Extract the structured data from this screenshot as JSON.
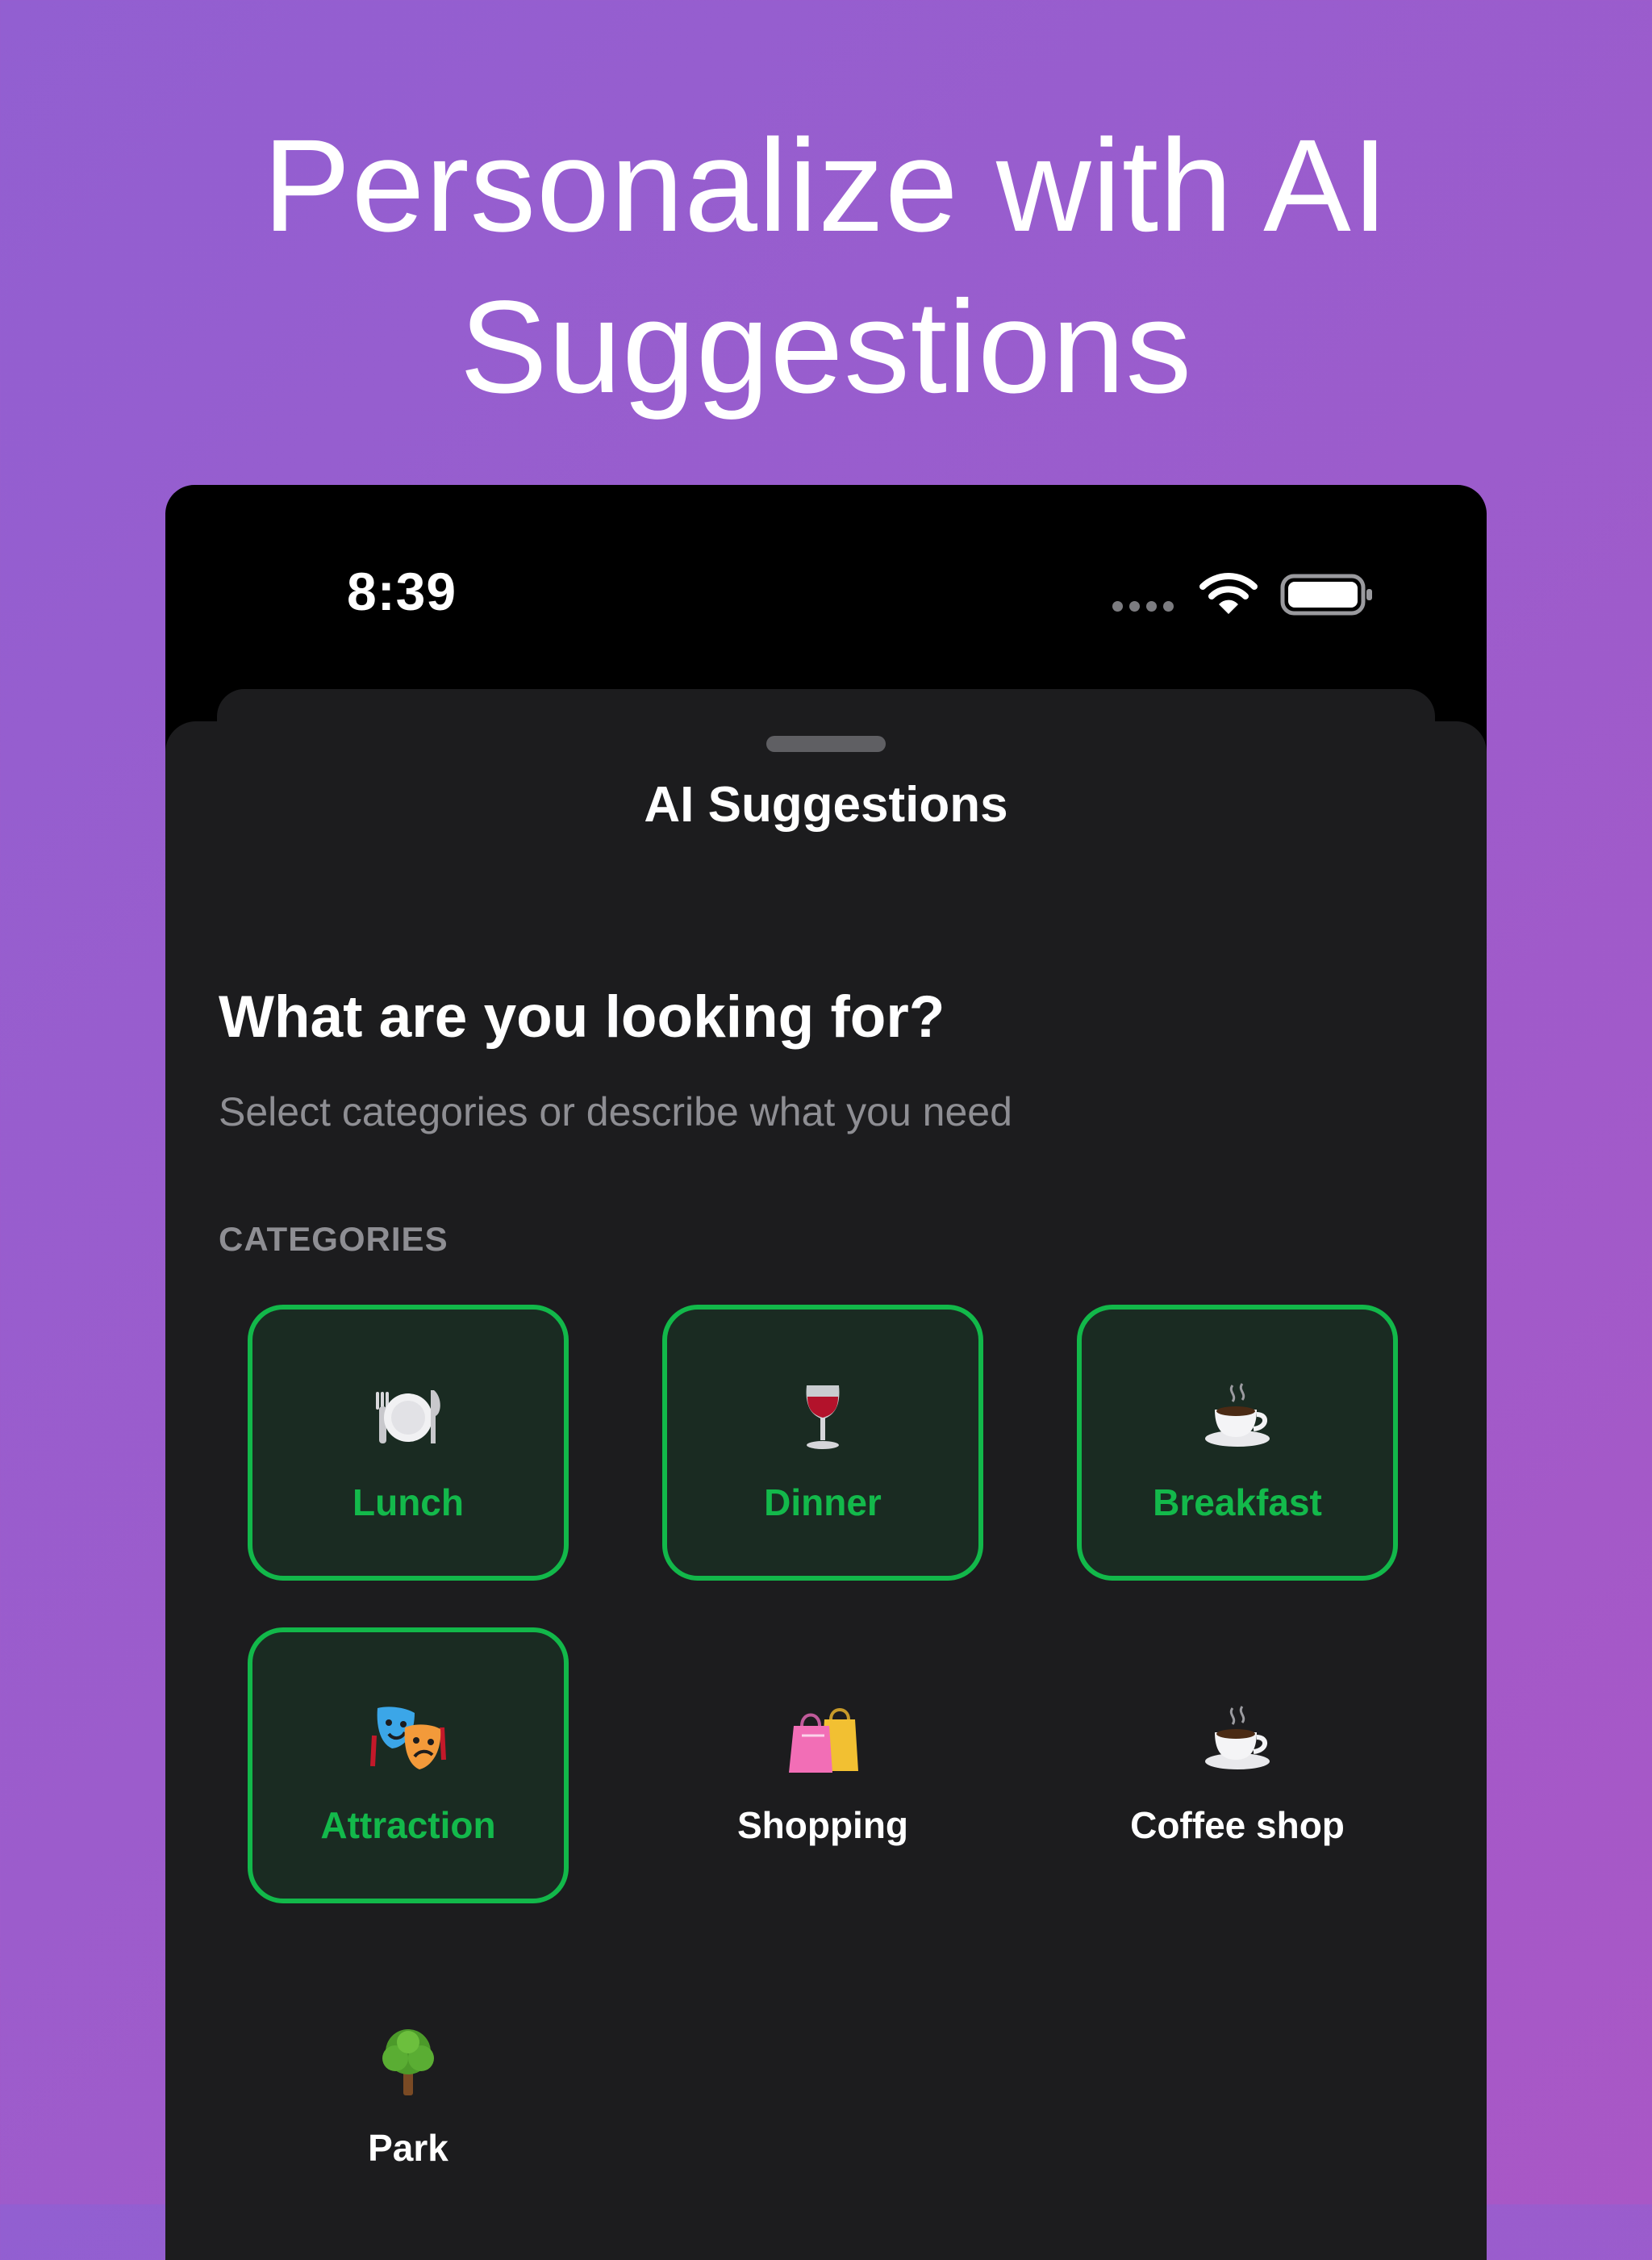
{
  "headline": {
    "line1": "Personalize with AI",
    "line2": "Suggestions"
  },
  "status_bar": {
    "time": "8:39",
    "icons": [
      "cellular-dots-icon",
      "wifi-icon",
      "battery-icon"
    ]
  },
  "sheet": {
    "title": "AI Suggestions",
    "question": "What are you looking for?",
    "subtitle": "Select categories or describe what you need",
    "section_label": "CATEGORIES",
    "categories": [
      {
        "label": "Lunch",
        "icon": "plate-fork-knife-icon",
        "selected": true
      },
      {
        "label": "Dinner",
        "icon": "wine-glass-icon",
        "selected": true
      },
      {
        "label": "Breakfast",
        "icon": "coffee-cup-icon",
        "selected": true
      },
      {
        "label": "Attraction",
        "icon": "theater-masks-icon",
        "selected": true
      },
      {
        "label": "Shopping",
        "icon": "shopping-bags-icon",
        "selected": false
      },
      {
        "label": "Coffee shop",
        "icon": "coffee-cup-icon",
        "selected": false
      },
      {
        "label": "Park",
        "icon": "tree-icon",
        "selected": false
      }
    ]
  },
  "colors": {
    "accent": "#13b94b",
    "selected_tile_bg": "#1a2b22",
    "sheet_bg": "#1c1c1e",
    "background_gradient_start": "#925fd1",
    "background_gradient_end": "#a957c6"
  }
}
